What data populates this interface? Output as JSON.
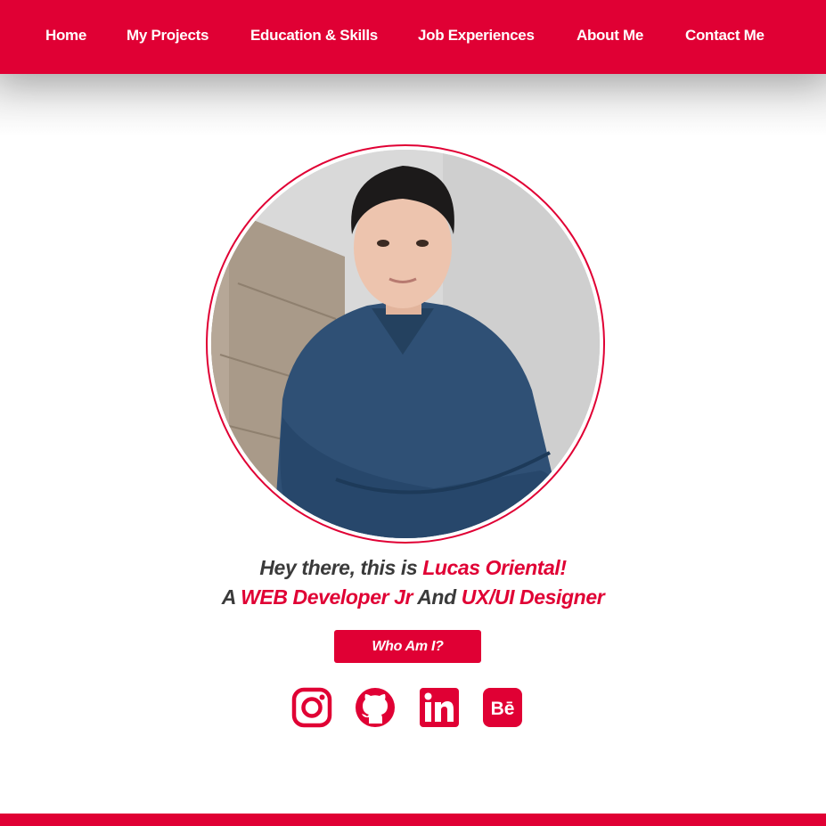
{
  "nav": {
    "items": [
      {
        "label": "Home"
      },
      {
        "label": "My Projects"
      },
      {
        "label": "Education & Skills"
      },
      {
        "label": "Job Experiences"
      },
      {
        "label": "About Me"
      },
      {
        "label": "Contact Me"
      }
    ]
  },
  "hero": {
    "line1_prefix": "Hey there, this is ",
    "name": "Lucas Oriental!",
    "line2_prefix": "A ",
    "role1": "WEB Developer Jr",
    "line2_mid": " And ",
    "role2": "UX/UI Designer",
    "cta_label": "Who Am I?"
  },
  "social": {
    "icons": [
      "instagram-icon",
      "github-icon",
      "linkedin-icon",
      "behance-icon"
    ],
    "behance_glyph": "Bē"
  },
  "colors": {
    "accent": "#e00034",
    "text": "#3a3a3a",
    "background": "#ffffff"
  }
}
